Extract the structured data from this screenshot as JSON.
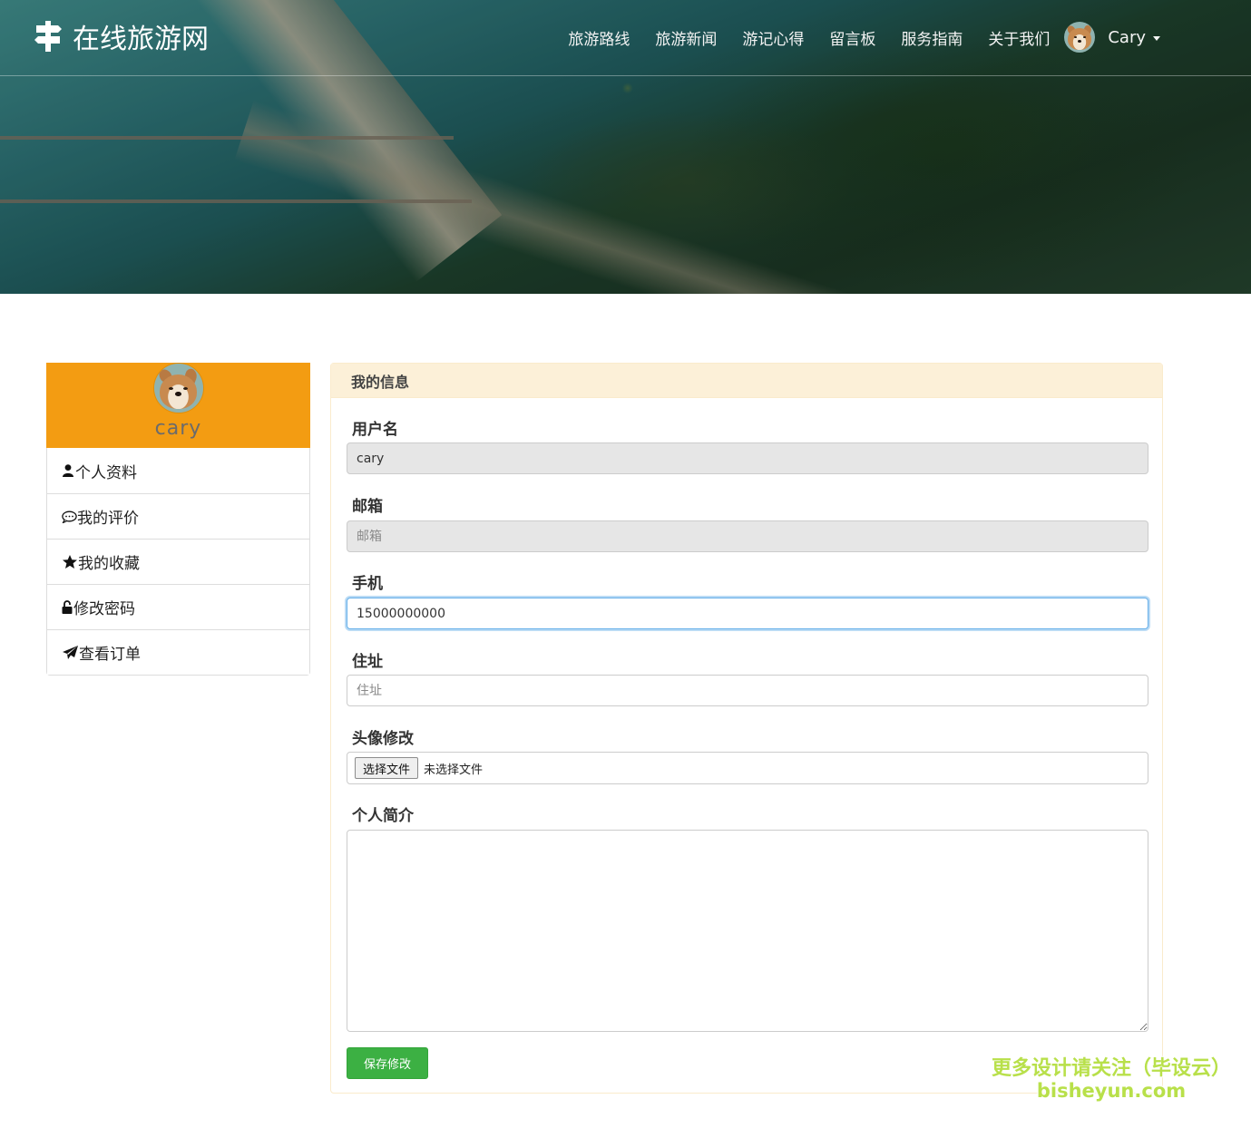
{
  "header": {
    "site_title": "在线旅游网",
    "nav": [
      {
        "label": "旅游路线"
      },
      {
        "label": "旅游新闻"
      },
      {
        "label": "游记心得"
      },
      {
        "label": "留言板"
      },
      {
        "label": "服务指南"
      },
      {
        "label": "关于我们"
      }
    ],
    "user_name": "Cary"
  },
  "sidebar": {
    "username": "cary",
    "items": [
      {
        "label": "个人资料",
        "icon": "user-icon"
      },
      {
        "label": "我的评价",
        "icon": "comment-icon"
      },
      {
        "label": "我的收藏",
        "icon": "star-icon"
      },
      {
        "label": "修改密码",
        "icon": "lock-icon"
      },
      {
        "label": "查看订单",
        "icon": "send-icon"
      }
    ]
  },
  "panel": {
    "title": "我的信息",
    "fields": {
      "username": {
        "label": "用户名",
        "value": "cary",
        "placeholder": ""
      },
      "email": {
        "label": "邮箱",
        "value": "",
        "placeholder": "邮箱"
      },
      "phone": {
        "label": "手机",
        "value": "15000000000",
        "placeholder": ""
      },
      "address": {
        "label": "住址",
        "value": "",
        "placeholder": "住址"
      },
      "avatar": {
        "label": "头像修改",
        "button": "选择文件",
        "status": "未选择文件"
      },
      "bio": {
        "label": "个人简介",
        "value": ""
      }
    },
    "save_label": "保存修改"
  },
  "watermark": {
    "line1": "更多设计请关注（毕设云）",
    "line2": "bisheyun.com"
  },
  "colors": {
    "sidebar_accent": "#f39c12",
    "panel_header": "#fcf0d8",
    "save_button": "#3cb043",
    "watermark": "#b8e04a"
  }
}
